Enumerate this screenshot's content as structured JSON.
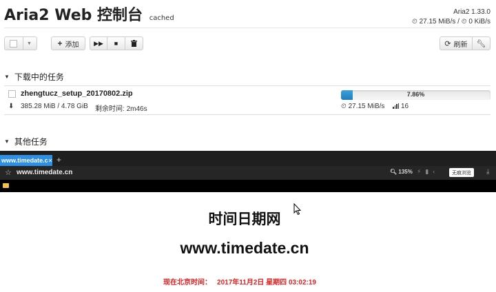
{
  "header": {
    "title": "Aria2 Web 控制台",
    "badge": "cached",
    "version": "Aria2 1.33.0",
    "download_speed": "27.15 MiB/s",
    "upload_speed": "0 KiB/s"
  },
  "toolbar": {
    "add_label": "添加",
    "refresh_label": "刷新"
  },
  "sections": {
    "downloading": "下载中的任务",
    "other": "其他任务"
  },
  "task": {
    "filename": "zhengtucz_setup_20170802.zip",
    "size": "385.28 MiB / 4.78 GiB",
    "remaining_label": "剩余时间:",
    "remaining_value": "2m46s",
    "progress_text": "7.86%",
    "progress_fraction": 0.0786,
    "speed": "27.15 MiB/s",
    "connections": "16"
  },
  "browser": {
    "tab_title": "www.timedate.c",
    "url": "www.timedate.cn",
    "zoom": "135%",
    "incognito_label": "无痕浏览"
  },
  "website": {
    "heading": "时间日期网",
    "domain": "www.timedate.cn",
    "time_label": "现在北京时间：",
    "time_value": "2017年11月2日 星期四 03:02:19",
    "time_color": "#e02020"
  },
  "colors": {
    "progress_fill": "#1a7fc0",
    "tab_active": "#2d8fe6"
  }
}
